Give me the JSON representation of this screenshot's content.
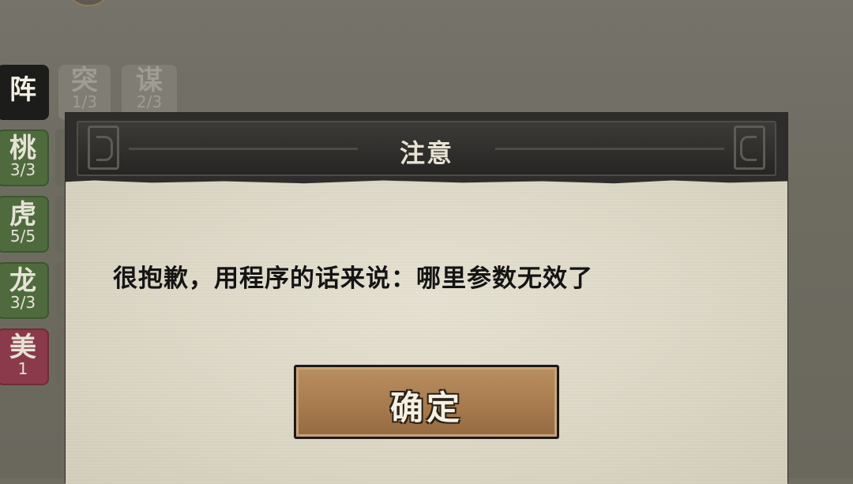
{
  "mode_tabs": [
    {
      "glyph": "阵",
      "count": ""
    },
    {
      "glyph": "突",
      "count": "1/3"
    },
    {
      "glyph": "谋",
      "count": "2/3"
    }
  ],
  "side_items": [
    {
      "glyph": "桃",
      "count": "3/3"
    },
    {
      "glyph": "虎",
      "count": "5/5"
    },
    {
      "glyph": "龙",
      "count": "3/3"
    },
    {
      "glyph": "美",
      "count": "1"
    }
  ],
  "dialog": {
    "title": "注意",
    "message": "很抱歉，用程序的话来说：哪里参数无效了",
    "confirm_label": "确定"
  },
  "colors": {
    "selected_tab": "#1c1c1a",
    "green_item": "#4f6b3e",
    "red_item": "#8a3a4a",
    "button": "#a87b4e"
  }
}
